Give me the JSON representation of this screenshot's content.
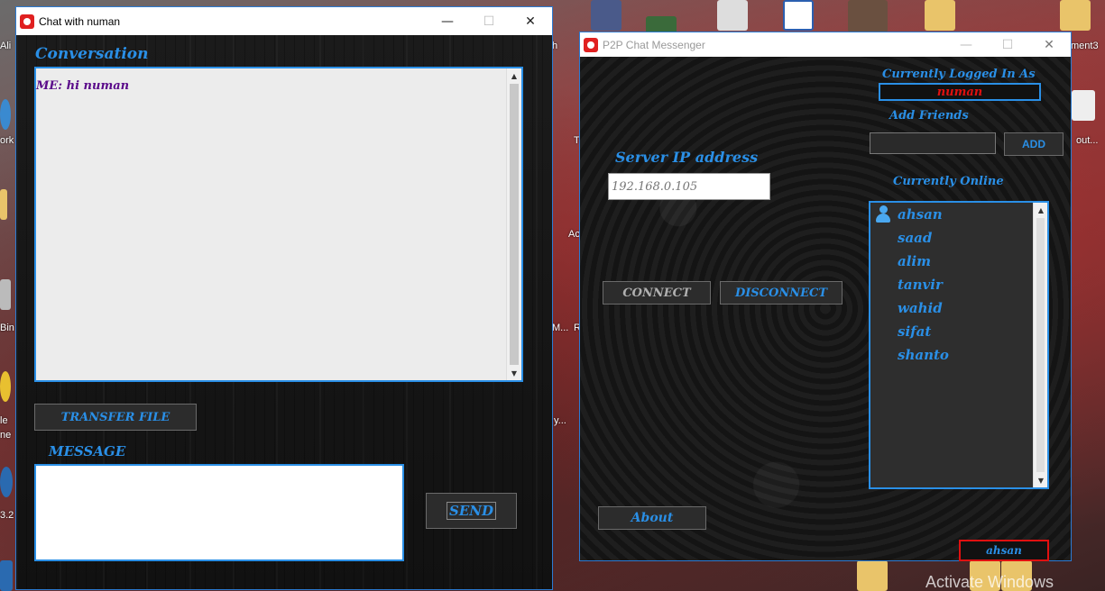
{
  "desktop": {
    "labels": [
      "Ali",
      "ork",
      "Bin",
      "le",
      "ne",
      "3.2",
      "h",
      "ment3",
      "out...",
      "T",
      "Ac",
      "R",
      "y...",
      "M..."
    ],
    "watermark": "Activate Windows"
  },
  "chat_window": {
    "title": "Chat with numan",
    "conversation_label": "Conversation",
    "conversation_lines": [
      "ME: hi numan"
    ],
    "transfer_button": "TRANSFER FILE",
    "message_label": "MESSAGE",
    "message_value": "",
    "send_button": "SEND"
  },
  "p2p_window": {
    "title": "P2P Chat Messenger",
    "logged_in_label": "Currently Logged In As",
    "logged_in_user": "numan",
    "add_friends_label": "Add Friends",
    "add_friend_value": "",
    "add_button": "ADD",
    "server_ip_label": "Server IP address",
    "server_ip_placeholder": "192.168.0.105",
    "connect_button": "CONNECT",
    "disconnect_button": "DISCONNECT",
    "online_label": "Currently Online",
    "online_users": [
      "ahsan",
      "saad",
      "alim",
      "tanvir",
      "wahid",
      "sifat",
      "shanto"
    ],
    "about_button": "About",
    "status_user": "ahsan"
  },
  "colors": {
    "accent": "#2a8fe6",
    "user_red": "#e01010",
    "conversation_text": "#5a0a8a"
  }
}
